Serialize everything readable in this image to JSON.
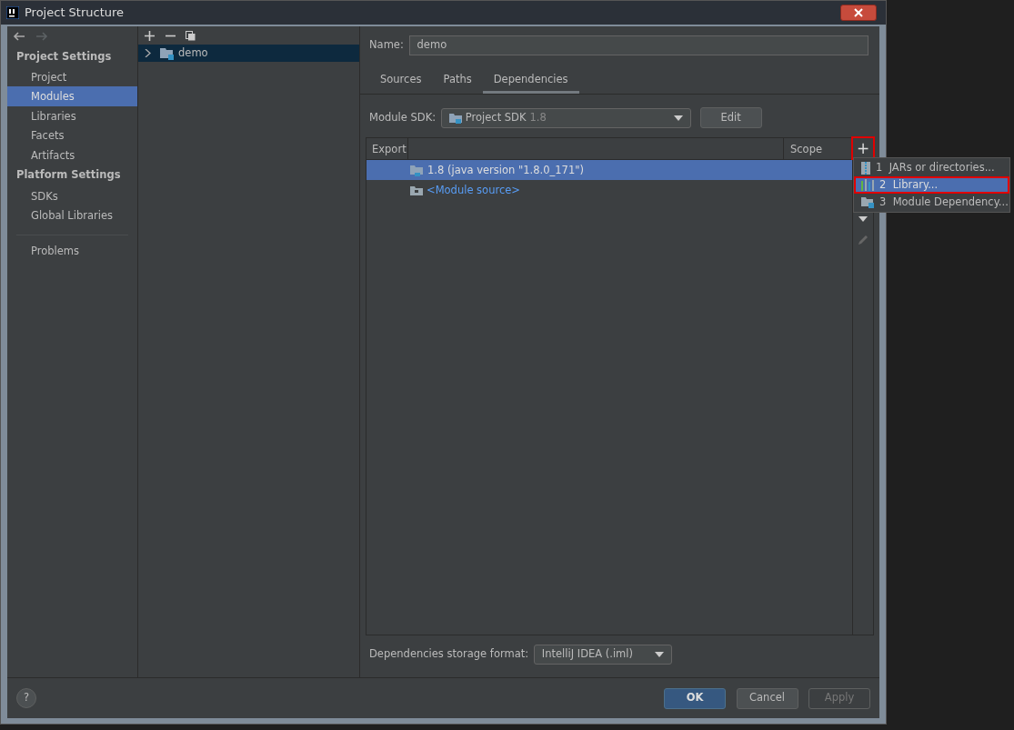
{
  "window": {
    "title": "Project Structure"
  },
  "sidebar": {
    "sections": [
      {
        "heading": "Project Settings",
        "items": [
          {
            "label": "Project",
            "selected": false
          },
          {
            "label": "Modules",
            "selected": true
          },
          {
            "label": "Libraries",
            "selected": false
          },
          {
            "label": "Facets",
            "selected": false
          },
          {
            "label": "Artifacts",
            "selected": false
          }
        ]
      },
      {
        "heading": "Platform Settings",
        "items": [
          {
            "label": "SDKs",
            "selected": false
          },
          {
            "label": "Global Libraries",
            "selected": false
          }
        ]
      }
    ],
    "extra_items": [
      {
        "label": "Problems",
        "selected": false
      }
    ]
  },
  "tree": [
    {
      "label": "demo",
      "expanded": false,
      "selected": true
    }
  ],
  "name_field": {
    "label": "Name:",
    "value": "demo"
  },
  "tabs": [
    {
      "label": "Sources",
      "selected": false
    },
    {
      "label": "Paths",
      "selected": false
    },
    {
      "label": "Dependencies",
      "selected": true
    }
  ],
  "module_sdk": {
    "label": "Module SDK:",
    "value": "Project SDK",
    "version": "1.8",
    "button": "Edit"
  },
  "table": {
    "columns": [
      "Export",
      "Scope"
    ],
    "rows": [
      {
        "kind": "sdk",
        "text": "1.8 (java version \"1.8.0_171\")",
        "selected": true
      },
      {
        "kind": "source",
        "text": "<Module source>",
        "selected": false
      }
    ]
  },
  "add_button": {
    "label": "+",
    "highlighted": true
  },
  "add_menu": [
    {
      "kind": "jar",
      "number": "1",
      "label": "JARs or directories...",
      "selected": false,
      "highlighted": false
    },
    {
      "kind": "library",
      "number": "2",
      "label": "Library...",
      "selected": true,
      "highlighted": true
    },
    {
      "kind": "module",
      "number": "3",
      "label": "Module Dependency...",
      "selected": false,
      "highlighted": false
    }
  ],
  "storage_format": {
    "label": "Dependencies storage format:",
    "value": "IntelliJ IDEA (.iml)"
  },
  "help_button": "?",
  "buttons": [
    {
      "label": "OK",
      "kind": "primary",
      "disabled": false
    },
    {
      "label": "Cancel",
      "kind": "normal",
      "disabled": false
    },
    {
      "label": "Apply",
      "kind": "normal",
      "disabled": true
    }
  ]
}
